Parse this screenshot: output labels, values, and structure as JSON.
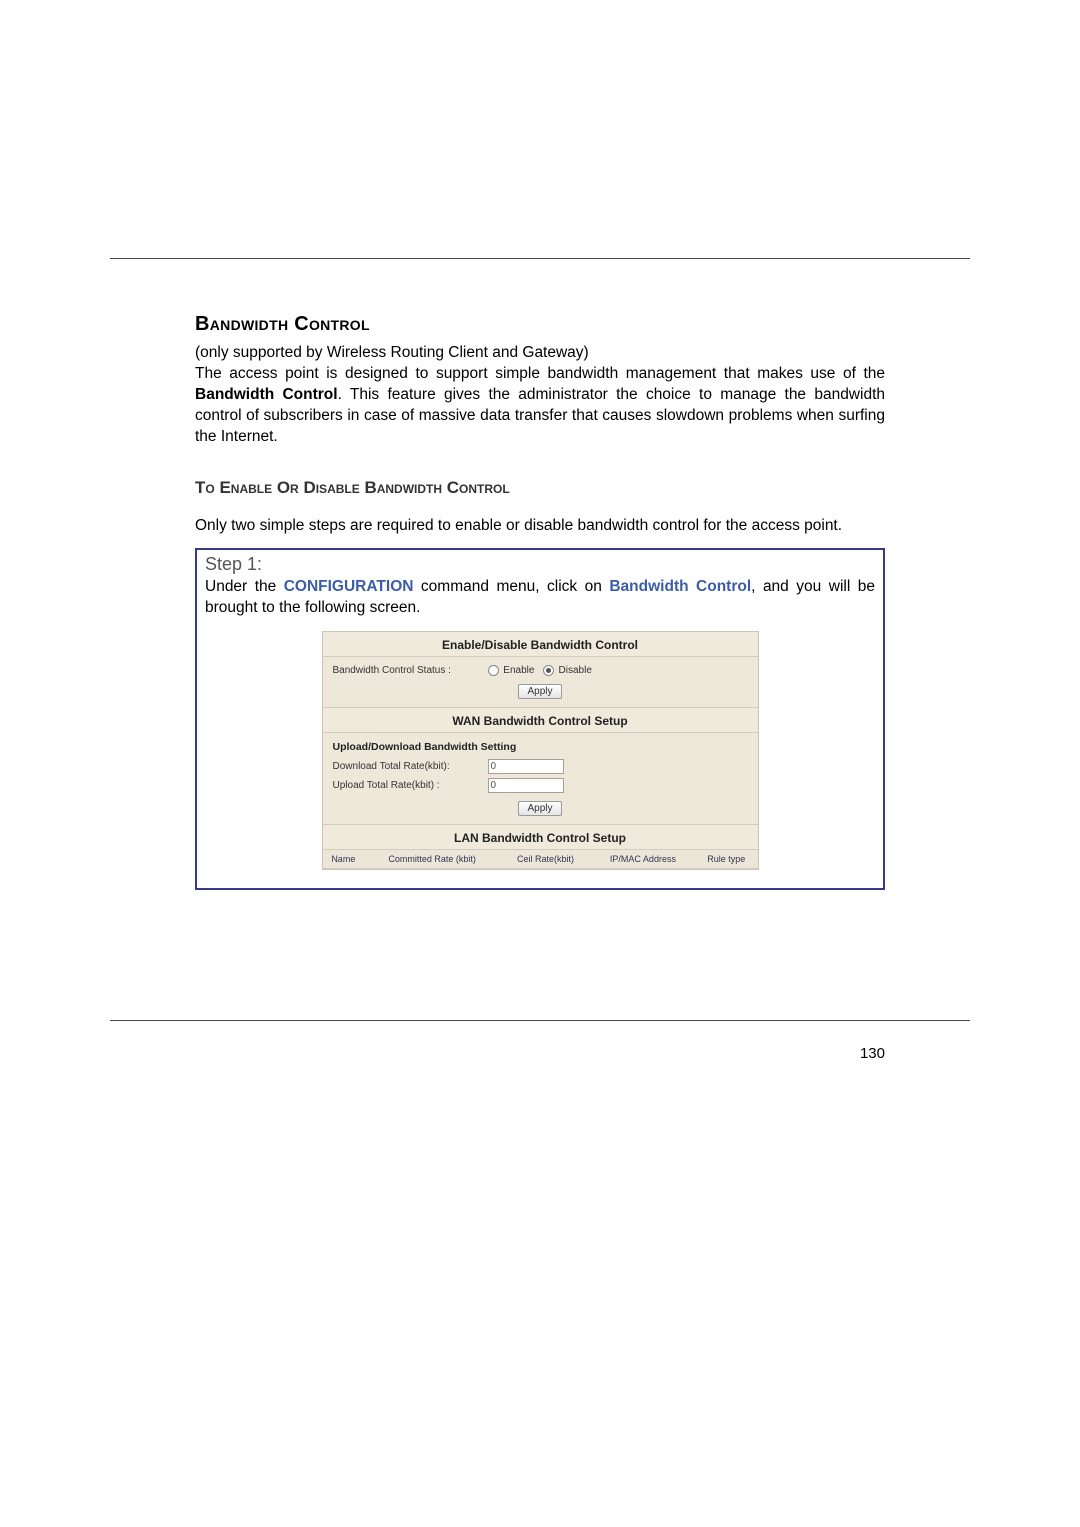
{
  "title": "Bandwidth Control",
  "intro_support": "(only supported by Wireless Routing Client and Gateway)",
  "intro_body_pre": "The access point is designed to support simple bandwidth management that makes use of the ",
  "intro_body_bold": "Bandwidth Control",
  "intro_body_post": ". This feature gives the administrator the choice to manage the bandwidth control of subscribers in case of massive data transfer   that causes slowdown problems when surfing the Internet.",
  "section_subtitle": "To Enable Or Disable Bandwidth Control",
  "section_intro": "Only two simple steps are required to enable or disable bandwidth control for the access point.",
  "step": {
    "title": "Step 1:",
    "body_pre": "Under the ",
    "kw_config": "CONFIGURATION",
    "body_mid": " command menu, click on ",
    "kw_link": "Bandwidth Control",
    "body_post": ", and you will be brought to the following screen."
  },
  "ui": {
    "sec1_title": "Enable/Disable Bandwidth Control",
    "status_label": "Bandwidth Control Status :",
    "radio_enable": "Enable",
    "radio_disable": "Disable",
    "apply_btn": "Apply",
    "sec2_title": "WAN Bandwidth Control Setup",
    "sub_bold": "Upload/Download Bandwidth Setting",
    "download_label": "Download Total Rate(kbit):",
    "download_value": "0",
    "upload_label": "Upload Total Rate(kbit) :",
    "upload_value": "0",
    "sec3_title": "LAN Bandwidth Control Setup",
    "lan_headers": {
      "c0": "Name",
      "c1": "Committed Rate (kbit)",
      "c2": "Ceil Rate(kbit)",
      "c3": "IP/MAC Address",
      "c4": "Rule type"
    }
  },
  "page_number": "130"
}
